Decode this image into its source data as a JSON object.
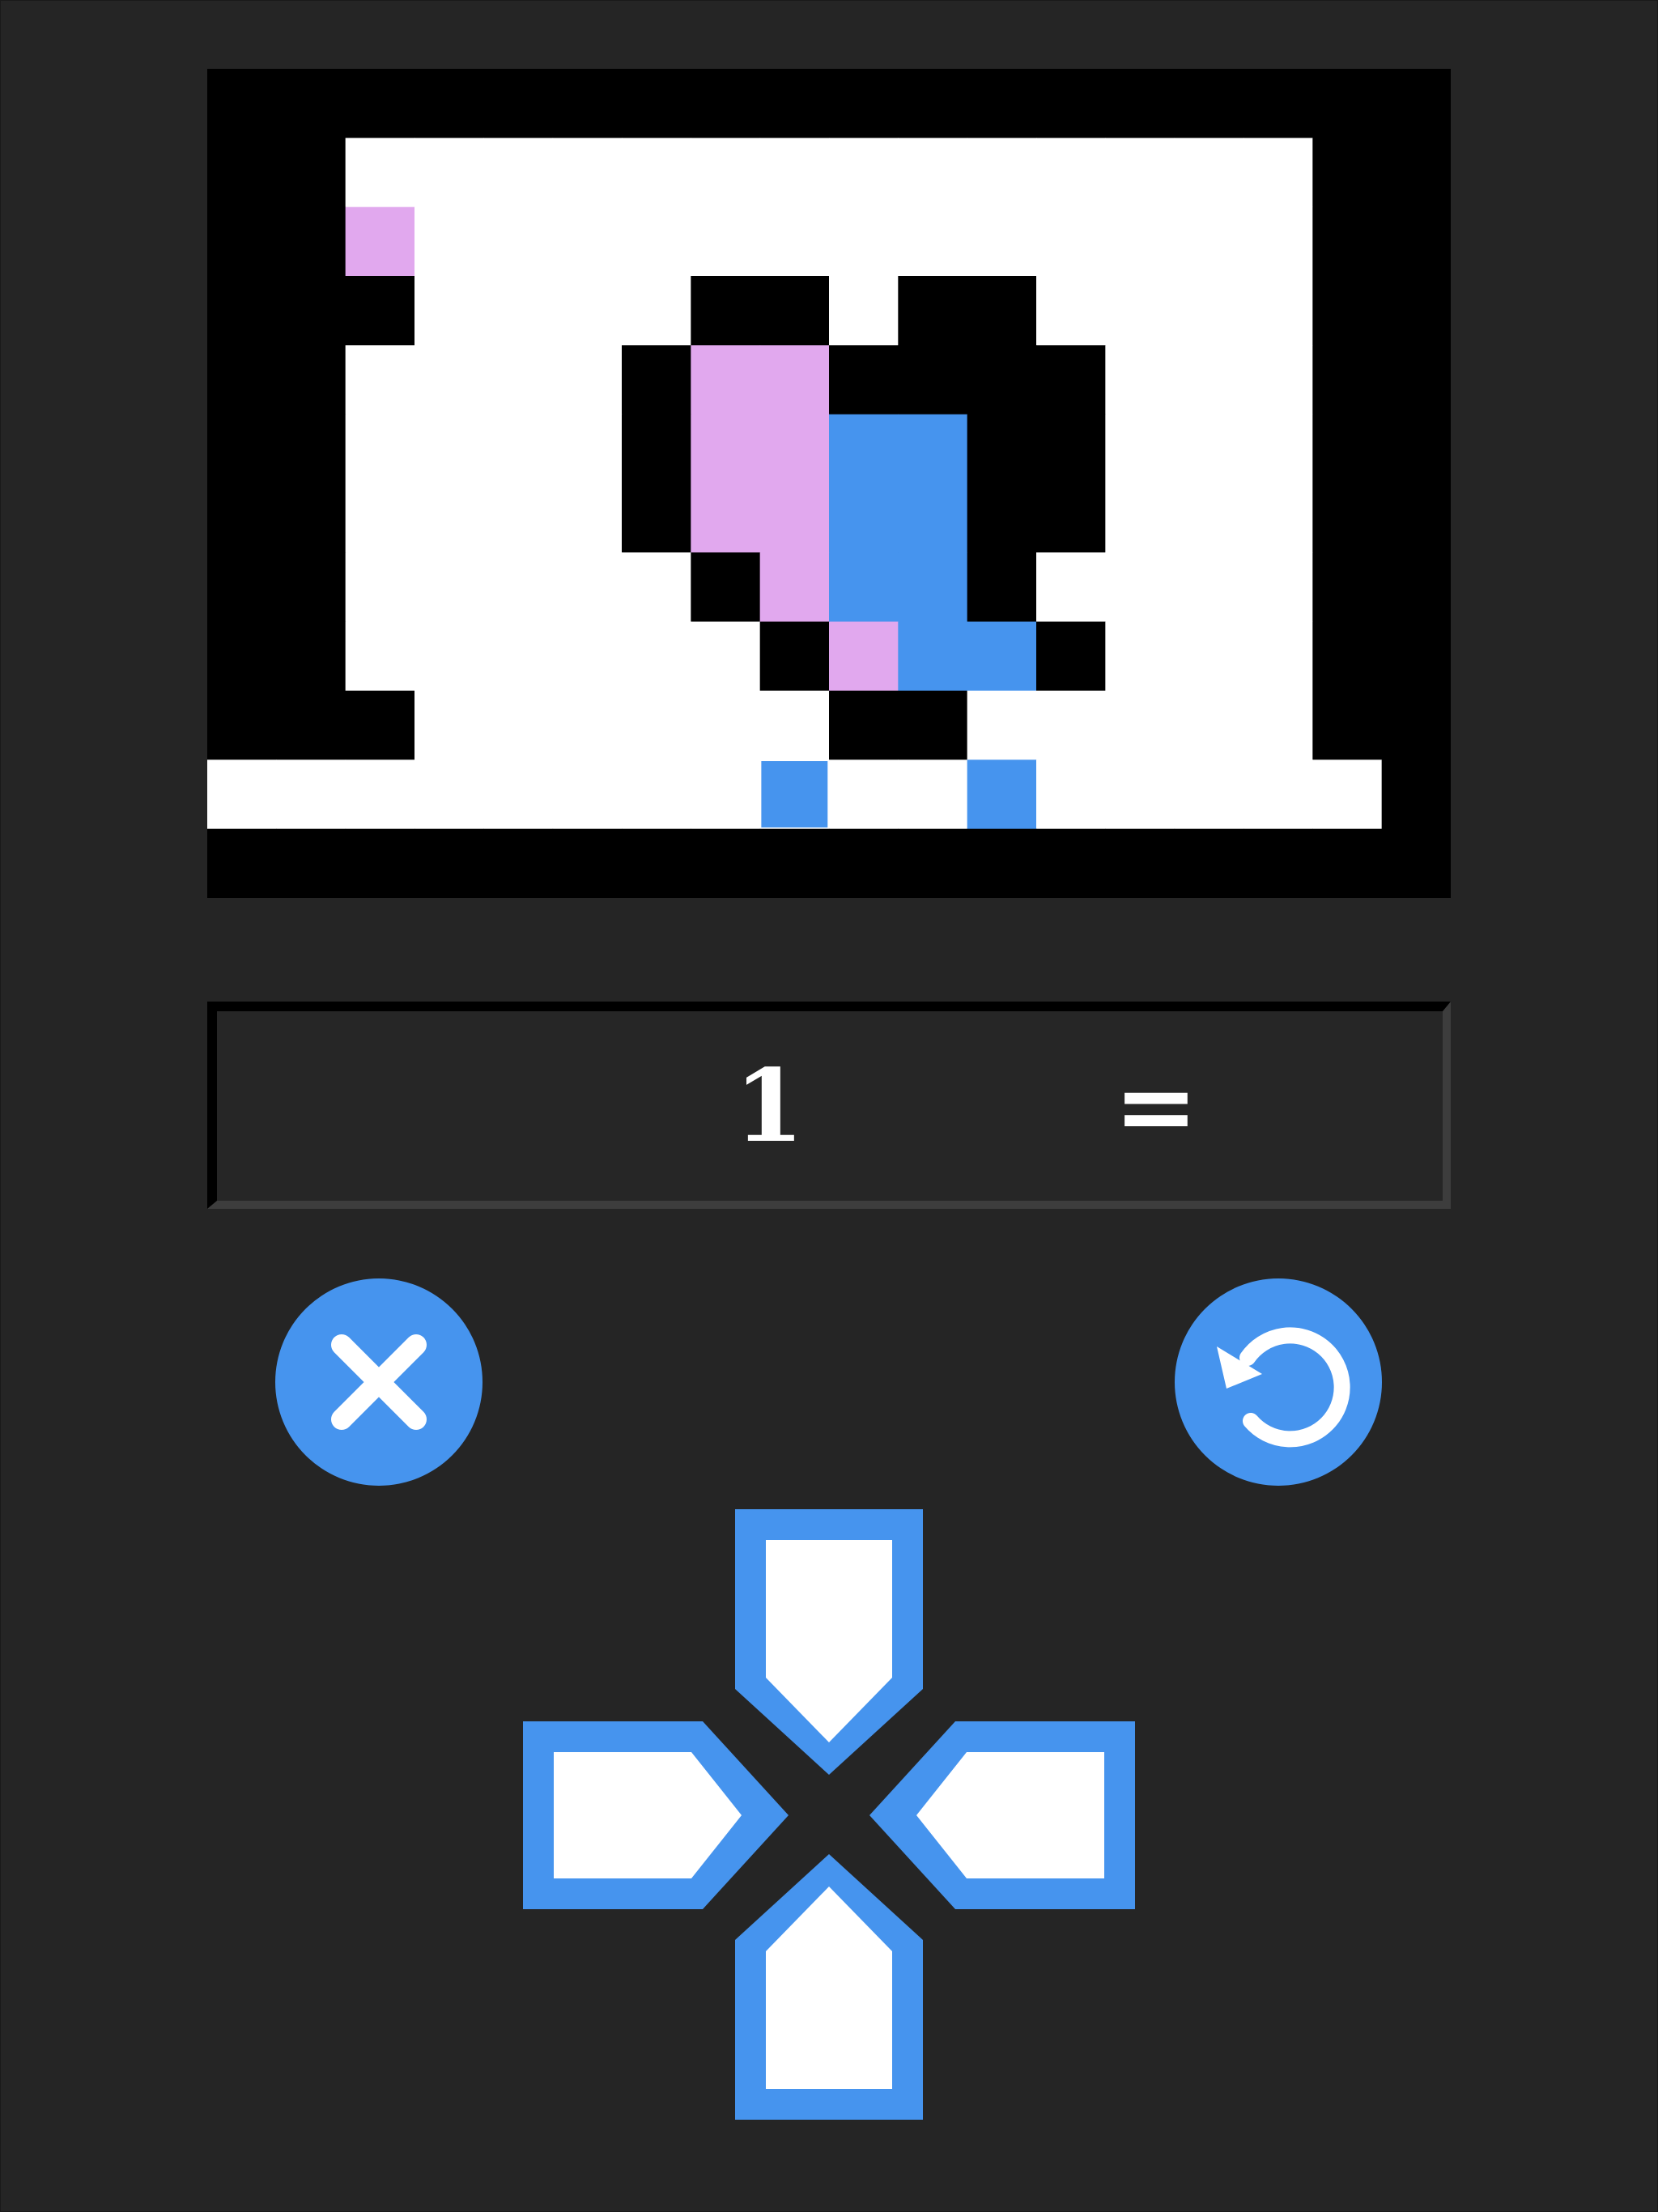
{
  "game": {
    "grid": {
      "cols": 18,
      "rows": 12,
      "palette": {
        "0": "#ffffff",
        "1": "#000000",
        "2": "#e1a8ee",
        "3": "#4694ee"
      },
      "cells": [
        "111111111111111111",
        "110000000000000011",
        "112000000000000011",
        "111000011011000011",
        "110000122111100011",
        "110000122331100011",
        "110000122331100011",
        "110000012331000011",
        "110000001233100011",
        "111000000110000011",
        "000000000003000001",
        "111111111111111111"
      ],
      "player": {
        "col": 8,
        "row": 10,
        "color": "#4694ee"
      }
    },
    "status": {
      "left_value": "1",
      "right_value": "="
    },
    "colors": {
      "background": "#252525",
      "accent": "#4694ee",
      "pink": "#e1a8ee",
      "button_glyph": "#ffffff"
    },
    "buttons": {
      "close_icon": "close-icon",
      "restart_icon": "restart-icon"
    },
    "dpad": {
      "up_icon": "arrow-up-icon",
      "down_icon": "arrow-down-icon",
      "left_icon": "arrow-left-icon",
      "right_icon": "arrow-right-icon"
    }
  }
}
